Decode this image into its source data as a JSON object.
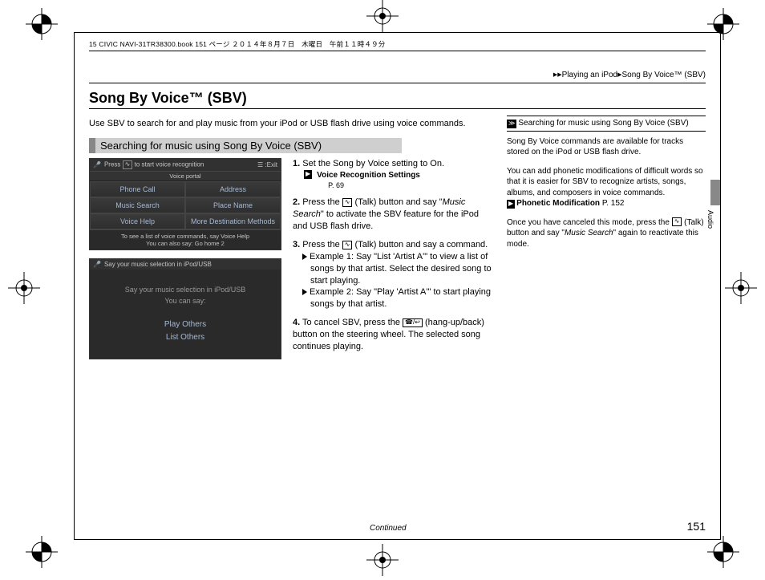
{
  "meta": {
    "bookline": "15 CIVIC NAVI-31TR38300.book  151 ページ  ２０１４年８月７日　木曜日　午前１１時４９分"
  },
  "breadcrumb": {
    "seg1": "Playing an iPod",
    "seg2": "Song By Voice™ (SBV)"
  },
  "title": "Song By Voice™ (SBV)",
  "intro": "Use SBV to search for and play music from your iPod or USB flash drive using voice commands.",
  "section_heading": "Searching for music using Song By Voice (SBV)",
  "screen1": {
    "titlebar_left": "Press",
    "titlebar_text": "to start voice recognition",
    "titlebar_right": ":Exit",
    "subtitle": "Voice portal",
    "cells": [
      "Phone Call",
      "Address",
      "Music Search",
      "Place Name",
      "Voice Help",
      "More Destination Methods"
    ],
    "footer1": "To see a list of voice commands, say  Voice Help",
    "footer2": "You can also say: Go home 2"
  },
  "screen2": {
    "titlebar": "Say your music selection in iPod/USB",
    "hint1": "Say your music selection in iPod/USB",
    "hint2": "You can say:",
    "opts": [
      "Play Others",
      "List Others"
    ]
  },
  "steps": {
    "s1a": "Set the ",
    "s1b": "Song by Voice",
    "s1c": " setting to ",
    "s1d": "On",
    "s1e": ".",
    "s1_link": "Voice Recognition Settings",
    "s1_page": "P. 69",
    "s2a": "Press the ",
    "s2b": " (Talk) button and say \"",
    "s2c": "Music Search",
    "s2d": "\" to activate the SBV feature for the iPod and USB flash drive.",
    "s3a": "Press the ",
    "s3b": " (Talk) button and say a command.",
    "s3_ex1": "Example 1: Say \"List 'Artist A'\" to view a list of songs by that artist. Select the desired song to start playing.",
    "s3_ex2": "Example 2: Say \"Play 'Artist A'\" to start playing songs by that artist.",
    "s4a": "To cancel SBV, press the ",
    "s4b": " (hang-up/back) button on the steering wheel. The selected song continues playing."
  },
  "side": {
    "head": "Searching for music using Song By Voice (SBV)",
    "p1": "Song By Voice commands are available for tracks stored on the iPod or USB flash drive.",
    "p2": "You can add phonetic modifications of difficult words so that it is easier for SBV to recognize artists, songs, albums, and composers in voice commands.",
    "link": "Phonetic Modification",
    "link_page": " P. 152",
    "p3a": "Once you have canceled this mode, press the ",
    "p3b": " (Talk) button and say \"",
    "p3c": "Music Search",
    "p3d": "\" again to reactivate this mode."
  },
  "tab_label": "Audio",
  "footer": {
    "continued": "Continued",
    "page": "151"
  }
}
